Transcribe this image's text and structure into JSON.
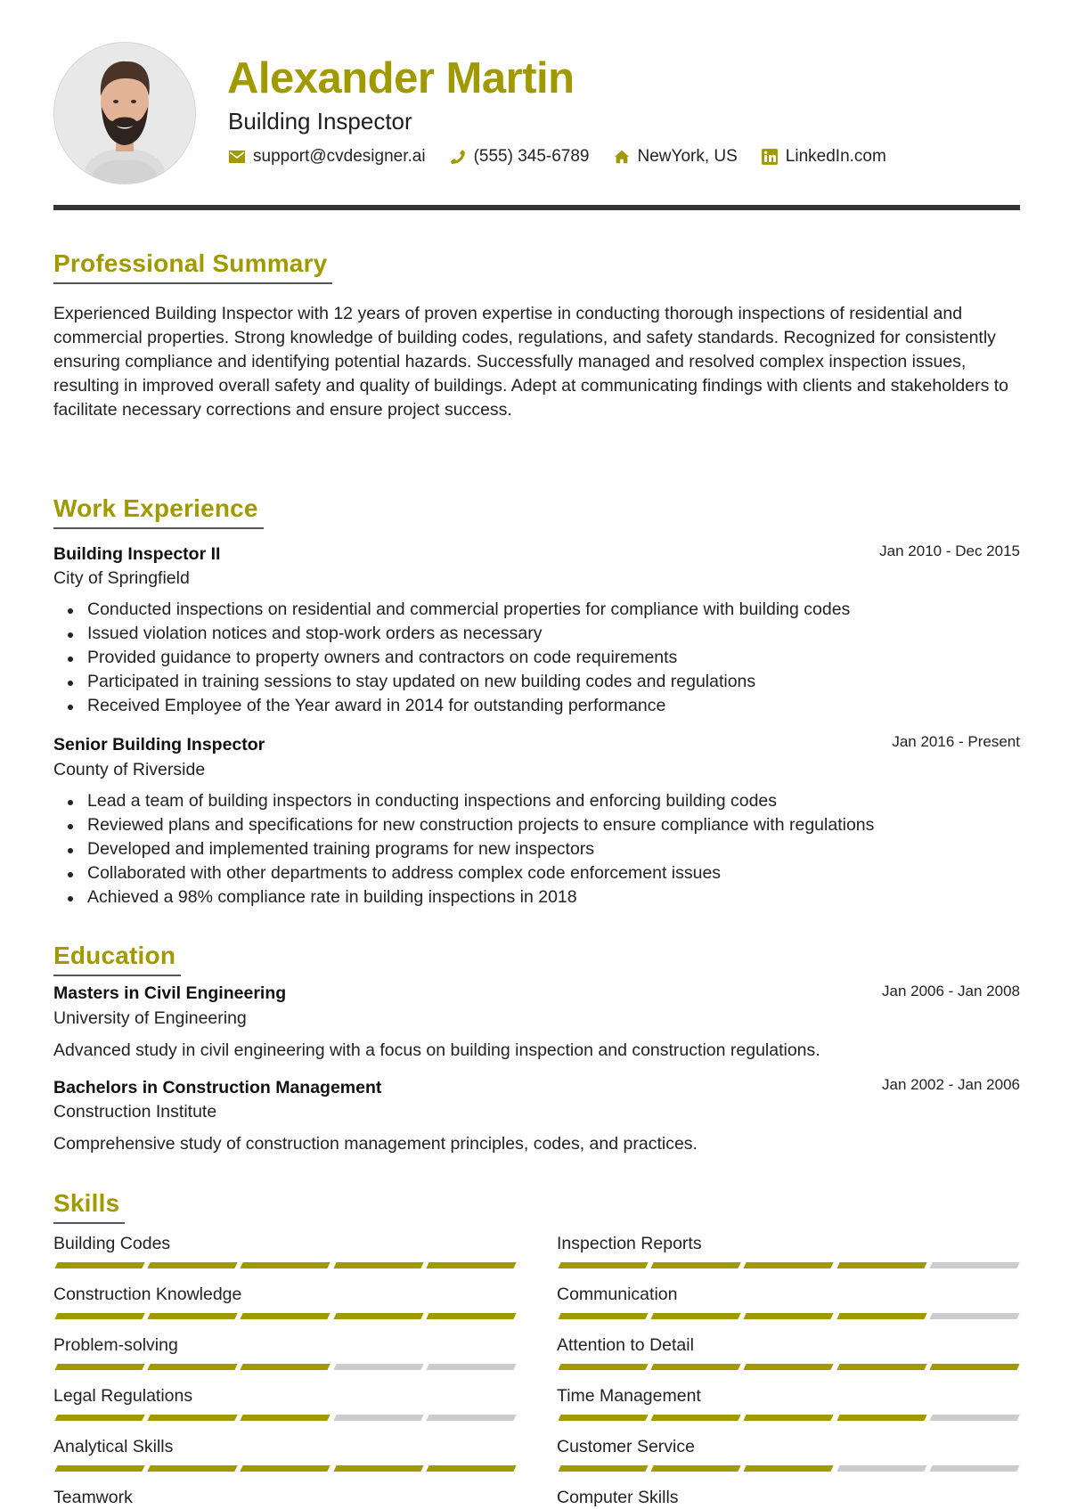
{
  "header": {
    "name": "Alexander Martin",
    "title": "Building Inspector",
    "accent_color": "#a09a00",
    "contacts": [
      {
        "icon": "envelope-icon",
        "text": "support@cvdesigner.ai"
      },
      {
        "icon": "phone-icon",
        "text": "(555) 345-6789"
      },
      {
        "icon": "home-icon",
        "text": "NewYork, US"
      },
      {
        "icon": "linkedin-icon",
        "text": "LinkedIn.com"
      }
    ]
  },
  "summary": {
    "heading": "Professional Summary",
    "text": "Experienced Building Inspector with 12 years of proven expertise in conducting thorough inspections of residential and commercial properties. Strong knowledge of building codes, regulations, and safety standards. Recognized for consistently ensuring compliance and identifying potential hazards. Successfully managed and resolved complex inspection issues, resulting in improved overall safety and quality of buildings. Adept at communicating findings with clients and stakeholders to facilitate necessary corrections and ensure project success."
  },
  "experience": {
    "heading": "Work Experience",
    "jobs": [
      {
        "title": "Building Inspector II",
        "company": "City of Springfield",
        "dates": "Jan 2010 - Dec 2015",
        "bullets": [
          "Conducted inspections on residential and commercial properties for compliance with building codes",
          "Issued violation notices and stop-work orders as necessary",
          "Provided guidance to property owners and contractors on code requirements",
          "Participated in training sessions to stay updated on new building codes and regulations",
          "Received Employee of the Year award in 2014 for outstanding performance"
        ]
      },
      {
        "title": "Senior Building Inspector",
        "company": "County of Riverside",
        "dates": "Jan 2016 - Present",
        "bullets": [
          "Lead a team of building inspectors in conducting inspections and enforcing building codes",
          "Reviewed plans and specifications for new construction projects to ensure compliance with regulations",
          "Developed and implemented training programs for new inspectors",
          "Collaborated with other departments to address complex code enforcement issues",
          "Achieved a 98% compliance rate in building inspections in 2018"
        ]
      }
    ]
  },
  "education": {
    "heading": "Education",
    "items": [
      {
        "degree": "Masters in Civil Engineering",
        "school": "University of Engineering",
        "dates": "Jan 2006 - Jan 2008",
        "description": "Advanced study in civil engineering with a focus on building inspection and construction regulations."
      },
      {
        "degree": "Bachelors in Construction Management",
        "school": "Construction Institute",
        "dates": "Jan 2002 - Jan 2006",
        "description": "Comprehensive study of construction management principles, codes, and practices."
      }
    ]
  },
  "skills": {
    "heading": "Skills",
    "max_level": 5,
    "items": [
      {
        "name": "Building Codes",
        "level": 5
      },
      {
        "name": "Inspection Reports",
        "level": 4
      },
      {
        "name": "Construction Knowledge",
        "level": 5
      },
      {
        "name": "Communication",
        "level": 4
      },
      {
        "name": "Problem-solving",
        "level": 3
      },
      {
        "name": "Attention to Detail",
        "level": 5
      },
      {
        "name": "Legal Regulations",
        "level": 3
      },
      {
        "name": "Time Management",
        "level": 4
      },
      {
        "name": "Analytical Skills",
        "level": 5
      },
      {
        "name": "Customer Service",
        "level": 3
      },
      {
        "name": "Teamwork",
        "level": null
      },
      {
        "name": "Computer Skills",
        "level": null
      }
    ]
  }
}
